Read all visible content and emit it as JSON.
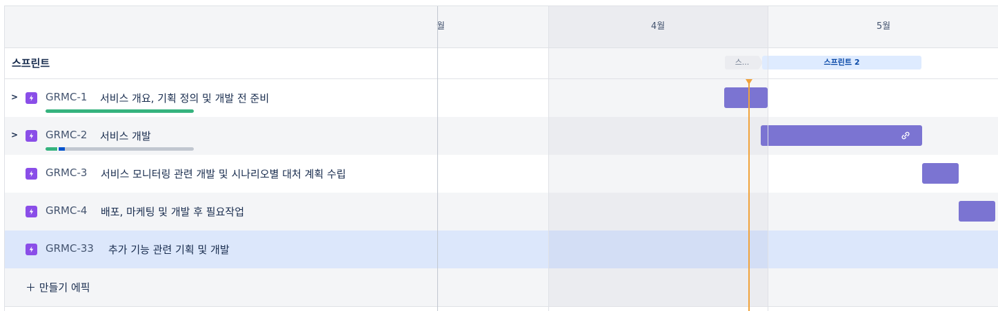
{
  "timeline": {
    "months": [
      {
        "label": "월"
      },
      {
        "label": "4월"
      },
      {
        "label": "5월"
      }
    ]
  },
  "sprints": {
    "row_label": "스프린트",
    "items": [
      {
        "label": "스..."
      },
      {
        "label": "스프린트 2"
      }
    ]
  },
  "epics": [
    {
      "key": "GRMC-1",
      "title": "서비스 개요, 기획 정의 및 개발 전 준비",
      "expandable": true,
      "progress": [
        {
          "color": "#36b37e",
          "fraction": 1.0
        }
      ],
      "bar_color": "#7b74d2"
    },
    {
      "key": "GRMC-2",
      "title": "서비스 개발",
      "expandable": true,
      "progress": [
        {
          "color": "#36b37e",
          "fraction": 0.08
        },
        {
          "color": "#0052cc",
          "fraction": 0.05
        },
        {
          "color": "#c1c7d0",
          "fraction": 0.87
        }
      ],
      "bar_color": "#7b74d2",
      "bar_icon": "link-icon"
    },
    {
      "key": "GRMC-3",
      "title": "서비스 모니터링 관련 개발 및 시나리오별 대처 계획 수립",
      "expandable": false,
      "bar_color": "#7b74d2"
    },
    {
      "key": "GRMC-4",
      "title": "배포, 마케팅 및 개발 후 필요작업",
      "expandable": false,
      "bar_color": "#7b74d2"
    },
    {
      "key": "GRMC-33",
      "title": "추가 기능 관련 기획 및 개발",
      "expandable": false,
      "selected": true
    }
  ],
  "add_epic": {
    "icon": "＋",
    "label": "만들기 에픽"
  },
  "colors": {
    "accent": "#7b74d2",
    "today_line": "#f0a23a",
    "selected_row": "#dce7fb",
    "epic_icon": "#8a4ee8"
  }
}
